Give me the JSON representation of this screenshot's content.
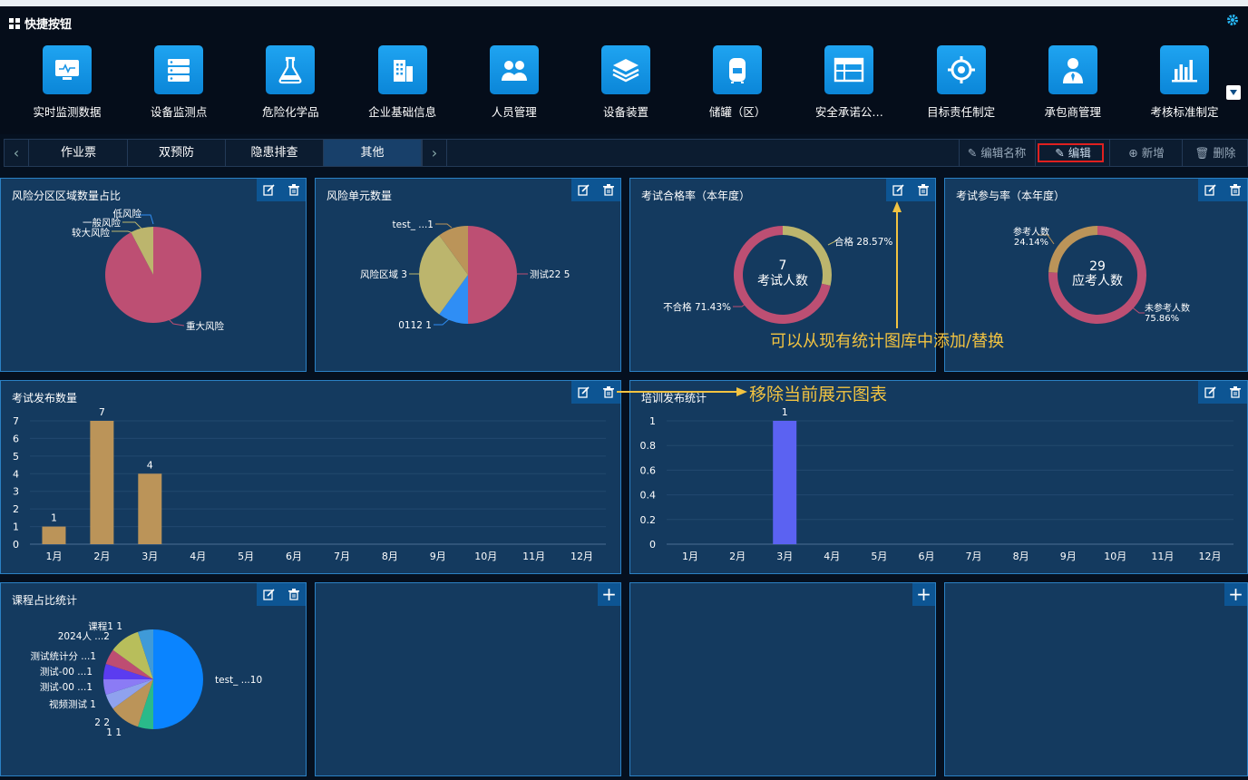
{
  "header": {
    "title": "快捷按钮"
  },
  "quick": [
    {
      "label": "实时监测数据",
      "icon": "monitor-icon"
    },
    {
      "label": "设备监测点",
      "icon": "server-icon"
    },
    {
      "label": "危险化学品",
      "icon": "flask-icon"
    },
    {
      "label": "企业基础信息",
      "icon": "building-icon"
    },
    {
      "label": "人员管理",
      "icon": "people-icon"
    },
    {
      "label": "设备装置",
      "icon": "layers-icon"
    },
    {
      "label": "储罐（区）",
      "icon": "tank-icon"
    },
    {
      "label": "安全承诺公…",
      "icon": "table-icon"
    },
    {
      "label": "目标责任制定",
      "icon": "target-icon"
    },
    {
      "label": "承包商管理",
      "icon": "person-tie-icon"
    },
    {
      "label": "考核标准制定",
      "icon": "bar-chart-icon"
    }
  ],
  "tabs": [
    "作业票",
    "双预防",
    "隐患排查",
    "其他"
  ],
  "actions": {
    "rename": "编辑名称",
    "edit": "编辑",
    "add": "新增",
    "delete": "删除"
  },
  "annotations": {
    "replace": "可以从现有统计图库中添加/替换",
    "remove": "移除当前展示图表"
  },
  "panels": {
    "risk_area": {
      "title": "风险分区区域数量占比",
      "labels": [
        "低风险",
        "一般风险",
        "较大风险",
        "重大风险"
      ]
    },
    "risk_unit": {
      "title": "风险单元数量",
      "labels": [
        "test_ ...1",
        "风险区域 3",
        "0112 1",
        "测试22 5"
      ]
    },
    "exam_pass": {
      "title": "考试合格率（本年度）",
      "center_value": "7",
      "center_label": "考试人数",
      "labels": [
        "合格 28.57%",
        "不合格 71.43%"
      ]
    },
    "exam_part": {
      "title": "考试参与率（本年度）",
      "center_value": "29",
      "center_label": "应考人数",
      "label_a1": "参考人数",
      "label_a2": "24.14%",
      "label_b1": "未参考人数",
      "label_b2": "75.86%"
    },
    "exam_pub": {
      "title": "考试发布数量"
    },
    "training": {
      "title": "培训发布统计"
    },
    "course": {
      "title": "课程占比统计",
      "labels": [
        "课程1 1",
        "2024人 ...2",
        "测试统计分 ...1",
        "测试-00 ...1",
        "测试-00 ...1",
        "视频测试 1",
        "2 2",
        "1 1",
        "test_ ...10"
      ]
    }
  },
  "chart_data": [
    {
      "type": "pie",
      "title": "风险分区区域数量占比",
      "categories": [
        "低风险",
        "一般风险",
        "较大风险",
        "重大风险"
      ],
      "values": [
        0,
        0,
        1,
        12
      ]
    },
    {
      "type": "pie",
      "title": "风险单元数量",
      "categories": [
        "测试22",
        "0112",
        "风险区域",
        "test_ ..."
      ],
      "values": [
        5,
        1,
        3,
        1
      ]
    },
    {
      "type": "pie",
      "title": "考试合格率（本年度）",
      "categories": [
        "合格",
        "不合格"
      ],
      "values": [
        28.57,
        71.43
      ]
    },
    {
      "type": "pie",
      "title": "考试参与率（本年度）",
      "categories": [
        "参考人数",
        "未参考人数"
      ],
      "values": [
        24.14,
        75.86
      ]
    },
    {
      "type": "bar",
      "title": "考试发布数量",
      "categories": [
        "1月",
        "2月",
        "3月",
        "4月",
        "5月",
        "6月",
        "7月",
        "8月",
        "9月",
        "10月",
        "11月",
        "12月"
      ],
      "values": [
        1,
        7,
        4,
        0,
        0,
        0,
        0,
        0,
        0,
        0,
        0,
        0
      ],
      "ylim": [
        0,
        7
      ],
      "yticks": [
        "0",
        "1",
        "2",
        "3",
        "4",
        "5",
        "6",
        "7"
      ],
      "data_labels": [
        "1",
        "7",
        "4"
      ]
    },
    {
      "type": "bar",
      "title": "培训发布统计",
      "categories": [
        "1月",
        "2月",
        "3月",
        "4月",
        "5月",
        "6月",
        "7月",
        "8月",
        "9月",
        "10月",
        "11月",
        "12月"
      ],
      "values": [
        0,
        0,
        1,
        0,
        0,
        0,
        0,
        0,
        0,
        0,
        0,
        0
      ],
      "ylim": [
        0,
        1
      ],
      "yticks": [
        "0",
        "0.2",
        "0.4",
        "0.6",
        "0.8",
        "1"
      ],
      "data_labels": [
        "1"
      ]
    },
    {
      "type": "pie",
      "title": "课程占比统计",
      "categories": [
        "test_ ...",
        "1",
        "2",
        "视频测试",
        "测试-00 ...",
        "测试-00 ...",
        "测试统计分 ...",
        "2024人 ...",
        "课程1"
      ],
      "values": [
        10,
        1,
        2,
        1,
        1,
        1,
        1,
        2,
        1
      ]
    }
  ],
  "colors": {
    "rose": "#bd4f73",
    "khaki": "#bcb56d",
    "tan": "#bb9459",
    "blue": "#2f8ef5",
    "violet": "#5b62f2",
    "bright_blue": "#0a84ff"
  }
}
